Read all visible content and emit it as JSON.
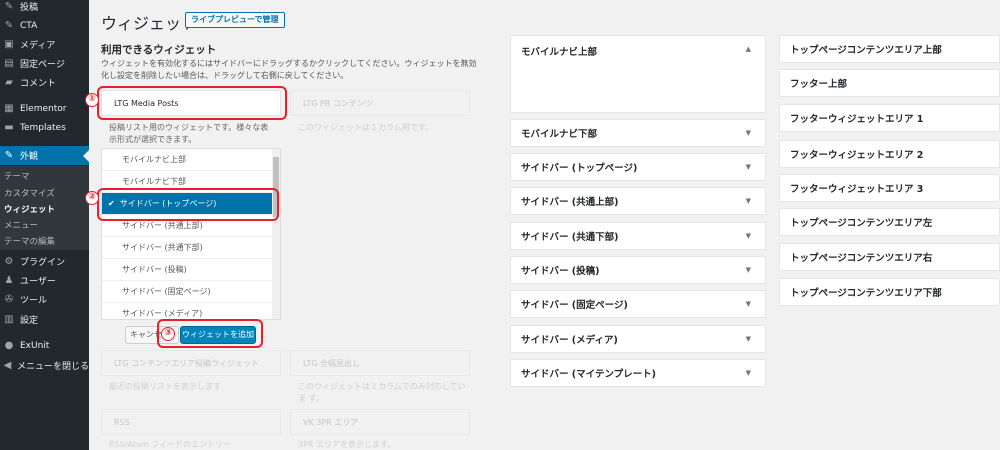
{
  "menu": [
    {
      "label": "投稿",
      "icon": "pin-icon",
      "glyph": "✎"
    },
    {
      "label": "CTA",
      "icon": "pin-icon",
      "glyph": "✎"
    },
    {
      "label": "メディア",
      "icon": "media-icon",
      "glyph": "▣"
    },
    {
      "label": "固定ページ",
      "icon": "page-icon",
      "glyph": "▤"
    },
    {
      "label": "コメント",
      "icon": "comment-icon",
      "glyph": "▰"
    },
    {
      "label": "Elementor",
      "icon": "elementor-icon",
      "glyph": "▦"
    },
    {
      "label": "Templates",
      "icon": "folder-icon",
      "glyph": "▬"
    },
    {
      "label": "外観",
      "icon": "brush-icon",
      "glyph": "✎"
    },
    {
      "label": "プラグイン",
      "icon": "plugin-icon",
      "glyph": "⚙"
    },
    {
      "label": "ユーザー",
      "icon": "user-icon",
      "glyph": "♟"
    },
    {
      "label": "ツール",
      "icon": "wrench-icon",
      "glyph": "✇"
    },
    {
      "label": "設定",
      "icon": "settings-icon",
      "glyph": "▥"
    },
    {
      "label": "ExUnit",
      "icon": "exunit-icon",
      "glyph": "●"
    },
    {
      "label": "メニューを閉じる",
      "icon": "collapse-icon",
      "glyph": "◀"
    }
  ],
  "submenu": [
    "テーマ",
    "カスタマイズ",
    "ウィジェット",
    "メニュー",
    "テーマの編集"
  ],
  "header": {
    "title": "ウィジェット",
    "action": "ライブプレビューで管理"
  },
  "available": {
    "title": "利用できるウィジェット",
    "desc": "ウィジェットを有効化するにはサイドバーにドラッグするかクリックしてください。ウィジェットを無効化し設定を削除したい場合は、ドラッグして右側に戻してください。"
  },
  "widgets": {
    "ltg_media_posts": "LTG Media Posts",
    "ltg_media_posts_desc": "投稿リスト用のウィジェットです。様々な表示形式が選択できます。",
    "ltg_pr": "LTG PR コンテンツ",
    "ltg_pr_desc": "このウィジェットは１カラム用です。",
    "ltg_content_area": "LTG コンテンツエリア投稿ウィジェット",
    "ltg_content_area_desc": "最近の投稿リストを表示します",
    "ltg_full_heading": "LTG 全幅見出し",
    "ltg_full_heading_desc": "このウィジェットは１カラムでのみ対応していま す。",
    "rss": "RSS",
    "rss_desc": "RSS/Atom フィードのエントリー",
    "vk_pr": "VK 3PR エリア",
    "vk_pr_desc": "3PR エリアを表示します。"
  },
  "chooser": {
    "items": [
      "モバイルナビ上部",
      "モバイルナビ下部",
      "サイドバー (トップページ)",
      "サイドバー (共通上部)",
      "サイドバー (共通下部)",
      "サイドバー (投稿)",
      "サイドバー (固定ページ)",
      "サイドバー (メディア)"
    ],
    "selected_index": 2,
    "check": "✔",
    "cancel": "キャンセル",
    "add": "ウィジェットを追加"
  },
  "annotations": [
    "①",
    "②",
    "③"
  ],
  "sidebars_middle": [
    "モバイルナビ上部",
    "モバイルナビ下部",
    "サイドバー (トップページ)",
    "サイドバー (共通上部)",
    "サイドバー (共通下部)",
    "サイドバー (投稿)",
    "サイドバー (固定ページ)",
    "サイドバー (メディア)",
    "サイドバー (マイテンプレート)"
  ],
  "sidebars_right": [
    "トップページコンテンツエリア上部",
    "フッター上部",
    "フッターウィジェットエリア 1",
    "フッターウィジェットエリア 2",
    "フッターウィジェットエリア 3",
    "トップページコンテンツエリア左",
    "トップページコンテンツエリア右",
    "トップページコンテンツエリア下部"
  ],
  "arrows": {
    "up": "▲",
    "down": "▼"
  },
  "colors": {
    "admin_bar": "#23282d",
    "accent": "#0073aa",
    "annotation": "#e8202b"
  }
}
